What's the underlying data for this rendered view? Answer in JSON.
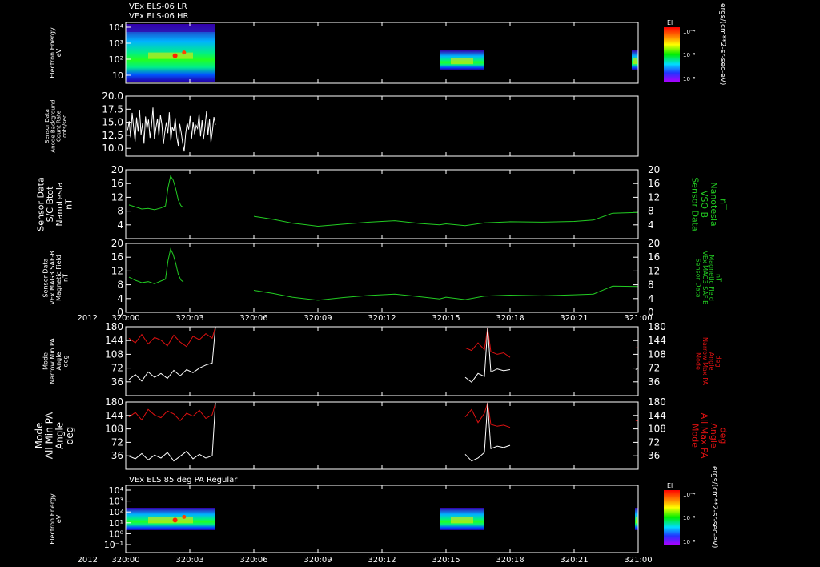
{
  "colors": {
    "background": "#000000",
    "frame": "#ffffff",
    "text": "#ffffff",
    "green": "#22cc22",
    "red": "#dd1111",
    "white": "#ffffff"
  },
  "header": {
    "line1": "VEx ELS-06 LR",
    "line2": "VEx ELS-06 HR"
  },
  "time_axis": {
    "ticks": [
      "320:00",
      "320:03",
      "320:06",
      "320:09",
      "320:12",
      "320:15",
      "320:18",
      "320:21",
      "321:00"
    ],
    "year": "2012"
  },
  "colorbar": {
    "title": "El",
    "ticks": [
      "10⁻⁴",
      "10⁻⁶",
      "10⁻⁸"
    ],
    "units": "ergs/(cm**2-sr-sec-eV)"
  },
  "chart_data": [
    {
      "type": "heatmap",
      "id": "spec1",
      "ylabel": [
        "Electron Energy",
        "eV"
      ],
      "yticks": [
        "10⁴",
        "10³",
        "10²",
        "10"
      ],
      "log_y": true,
      "time_coverage_min": [
        [
          0,
          1.4
        ],
        [
          4.9,
          5.6
        ],
        [
          7.9,
          8.0
        ]
      ]
    },
    {
      "type": "line",
      "id": "background",
      "ylabel": [
        "Sensor Data",
        "Anode Background",
        "Count Rate",
        "cnts/sec"
      ],
      "ylim": [
        8.5,
        20.0
      ],
      "yticks": [
        "20.0",
        "17.5",
        "15.0",
        "12.5",
        "10.0"
      ],
      "series": [
        {
          "color": "white",
          "x_start_min": 0.03,
          "x_end_min": 1.4,
          "y": [
            13.5,
            15.2,
            12.1,
            16.8,
            14.0,
            11.3,
            15.9,
            13.2,
            17.4,
            12.6,
            14.8,
            10.9,
            16.1,
            13.7,
            15.5,
            12.0,
            14.3,
            17.8,
            11.8,
            13.9,
            15.7,
            12.4,
            16.4,
            14.6,
            10.8,
            13.1,
            15.0,
            12.9,
            16.9,
            11.5,
            14.1,
            13.3,
            15.8,
            12.2,
            10.5,
            14.7,
            13.0,
            11.0,
            9.4,
            12.8,
            14.9,
            13.6,
            16.2,
            11.9,
            15.1,
            12.7,
            14.4,
            13.8,
            16.6,
            12.3,
            15.4,
            11.7,
            14.2,
            17.1,
            12.5,
            15.6,
            11.2,
            13.4,
            16.0,
            14.5
          ]
        }
      ]
    },
    {
      "type": "line",
      "id": "scbmag",
      "ylabel": [
        "Sensor Data",
        "S/C Btot",
        "Nanotesla",
        "nT"
      ],
      "ylabel_right": [
        "Sensor Data",
        "VSO B",
        "Nanotesla",
        "nT"
      ],
      "ylim": [
        0,
        20
      ],
      "yticks": [
        "20",
        "16",
        "12",
        "8",
        "4"
      ],
      "series": [
        {
          "color": "green",
          "segments": [
            {
              "x": [
                0.05,
                0.15,
                0.25,
                0.35,
                0.45,
                0.55,
                0.62,
                0.66,
                0.7,
                0.74,
                0.78,
                0.82,
                0.86,
                0.9
              ],
              "y": [
                9.8,
                9.2,
                8.6,
                8.8,
                8.4,
                8.9,
                9.5,
                14.8,
                18.2,
                17.0,
                14.5,
                11.2,
                9.6,
                9.0
              ]
            },
            {
              "x": [
                2.0,
                2.3,
                2.6,
                3.0,
                3.4,
                3.8,
                4.2,
                4.6,
                4.9,
                5.0,
                5.3,
                5.6,
                6.0,
                6.5,
                7.0,
                7.3,
                7.6,
                8.0
              ],
              "y": [
                6.5,
                5.6,
                4.5,
                3.6,
                4.2,
                4.8,
                5.2,
                4.4,
                4.0,
                4.3,
                3.8,
                4.6,
                4.9,
                4.8,
                5.0,
                5.4,
                7.4,
                7.6
              ]
            }
          ]
        }
      ]
    },
    {
      "type": "line",
      "id": "magsafb",
      "ylabel": [
        "Sensor Data",
        "VEx MAG3 SAF-B",
        "Magnetic Field",
        "nT"
      ],
      "ylabel_right": [
        "Sensor Data",
        "VEx MAG3 SAF-B",
        "Magnetic Field",
        "nT"
      ],
      "ylim": [
        0,
        20
      ],
      "yticks": [
        "20",
        "16",
        "12",
        "8",
        "4",
        "0"
      ],
      "series": [
        {
          "color": "green",
          "segments": [
            {
              "x": [
                0.05,
                0.15,
                0.25,
                0.35,
                0.45,
                0.55,
                0.62,
                0.66,
                0.7,
                0.74,
                0.78,
                0.82,
                0.86,
                0.9
              ],
              "y": [
                10.2,
                9.3,
                8.6,
                8.9,
                8.3,
                9.1,
                9.6,
                15.0,
                18.4,
                16.8,
                14.2,
                11.0,
                9.4,
                8.8
              ]
            },
            {
              "x": [
                2.0,
                2.3,
                2.6,
                3.0,
                3.4,
                3.8,
                4.2,
                4.6,
                4.9,
                5.0,
                5.3,
                5.6,
                6.0,
                6.5,
                7.0,
                7.3,
                7.6,
                8.0
              ],
              "y": [
                6.4,
                5.5,
                4.4,
                3.5,
                4.3,
                4.9,
                5.3,
                4.5,
                3.9,
                4.4,
                3.7,
                4.7,
                5.0,
                4.8,
                5.1,
                5.3,
                7.6,
                7.5
              ]
            }
          ]
        }
      ]
    },
    {
      "type": "line",
      "id": "narrowpa",
      "ylabel": [
        "Mode",
        "Narrow Min PA",
        "Angle",
        "deg"
      ],
      "ylabel_right": [
        "Mode",
        "Narrow Max PA",
        "Angle",
        "deg"
      ],
      "ylim": [
        0,
        180
      ],
      "yticks": [
        "180",
        "144",
        "108",
        "72",
        "36"
      ],
      "series": [
        {
          "color": "red",
          "segments": [
            {
              "x": [
                0.05,
                0.15,
                0.25,
                0.35,
                0.45,
                0.55,
                0.65,
                0.75,
                0.85,
                0.95,
                1.05,
                1.15,
                1.25,
                1.35,
                1.4
              ],
              "y": [
                150,
                138,
                160,
                135,
                152,
                145,
                130,
                158,
                140,
                128,
                155,
                146,
                162,
                150,
                180
              ]
            },
            {
              "x": [
                5.3,
                5.4,
                5.5,
                5.6,
                5.65,
                5.7,
                5.8,
                5.9,
                6.0
              ],
              "y": [
                125,
                118,
                138,
                120,
                178,
                115,
                108,
                112,
                100
              ]
            },
            {
              "x": [
                7.96,
                8.0
              ],
              "y": [
                125,
                125
              ]
            }
          ]
        },
        {
          "color": "white",
          "segments": [
            {
              "x": [
                0.05,
                0.15,
                0.25,
                0.35,
                0.45,
                0.55,
                0.65,
                0.75,
                0.85,
                0.95,
                1.05,
                1.15,
                1.25,
                1.35,
                1.4
              ],
              "y": [
                42,
                55,
                38,
                62,
                48,
                58,
                45,
                66,
                52,
                68,
                60,
                72,
                80,
                85,
                180
              ]
            },
            {
              "x": [
                5.3,
                5.4,
                5.5,
                5.6,
                5.65,
                5.7,
                5.8,
                5.9,
                6.0
              ],
              "y": [
                48,
                35,
                58,
                50,
                178,
                62,
                70,
                65,
                68
              ]
            },
            {
              "x": [
                7.96,
                8.0
              ],
              "y": [
                68,
                72
              ]
            }
          ]
        }
      ]
    },
    {
      "type": "line",
      "id": "allpa",
      "ylabel": [
        "Mode",
        "All Min PA",
        "Angle",
        "deg"
      ],
      "ylabel_right": [
        "Mode",
        "All Max PA",
        "Angle",
        "deg"
      ],
      "ylim": [
        0,
        180
      ],
      "yticks": [
        "180",
        "144",
        "108",
        "72",
        "36"
      ],
      "series": [
        {
          "color": "red",
          "segments": [
            {
              "x": [
                0.05,
                0.15,
                0.25,
                0.35,
                0.45,
                0.55,
                0.65,
                0.75,
                0.85,
                0.95,
                1.05,
                1.15,
                1.25,
                1.35,
                1.4
              ],
              "y": [
                140,
                152,
                132,
                160,
                145,
                138,
                156,
                148,
                130,
                150,
                142,
                158,
                136,
                146,
                178
              ]
            },
            {
              "x": [
                5.3,
                5.4,
                5.5,
                5.6,
                5.65,
                5.7,
                5.8,
                5.9,
                6.0
              ],
              "y": [
                140,
                160,
                125,
                150,
                178,
                120,
                115,
                118,
                112
              ]
            },
            {
              "x": [
                7.96,
                8.0
              ],
              "y": [
                130,
                130
              ]
            }
          ]
        },
        {
          "color": "white",
          "segments": [
            {
              "x": [
                0.05,
                0.15,
                0.25,
                0.35,
                0.45,
                0.55,
                0.65,
                0.75,
                0.85,
                0.95,
                1.05,
                1.15,
                1.25,
                1.35,
                1.4
              ],
              "y": [
                35,
                28,
                42,
                25,
                38,
                30,
                45,
                22,
                35,
                48,
                28,
                40,
                30,
                36,
                178
              ]
            },
            {
              "x": [
                5.3,
                5.4,
                5.5,
                5.6,
                5.65,
                5.7,
                5.8,
                5.9,
                6.0
              ],
              "y": [
                40,
                22,
                30,
                45,
                178,
                55,
                62,
                58,
                64
              ]
            }
          ]
        }
      ]
    },
    {
      "type": "heatmap",
      "id": "spec2",
      "title": "VEx ELS 85 deg PA Regular",
      "ylabel": [
        "Electron Energy",
        "eV"
      ],
      "yticks": [
        "10⁴",
        "10³",
        "10²",
        "10¹",
        "10⁰",
        "10⁻¹"
      ],
      "log_y": true,
      "time_coverage_min": [
        [
          0,
          1.4
        ],
        [
          4.9,
          5.6
        ],
        [
          7.95,
          8.0
        ]
      ]
    }
  ]
}
